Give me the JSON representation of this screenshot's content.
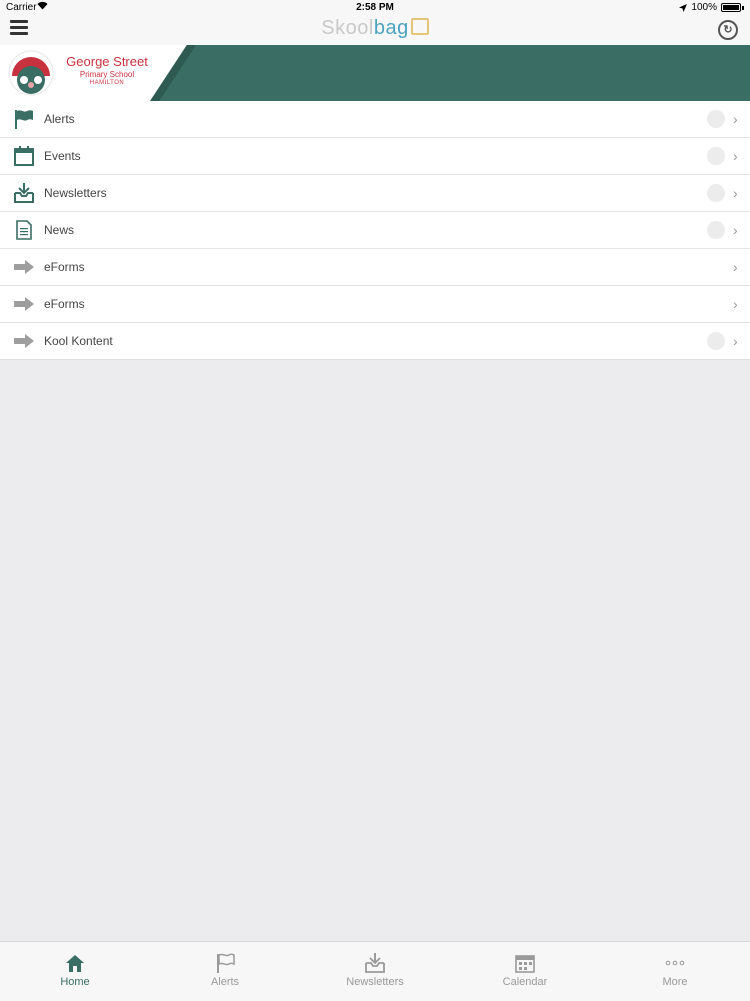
{
  "status": {
    "carrier": "Carrier",
    "time": "2:58 PM",
    "battery": "100%"
  },
  "header": {
    "brand_part1": "Skool",
    "brand_part2": "bag"
  },
  "banner": {
    "school_line1": "George Street",
    "school_line2": "Primary School",
    "school_line3": "HAMILTON",
    "accent": "#3a6d63"
  },
  "menu": {
    "items": [
      {
        "label": "Alerts",
        "icon": "flag-icon",
        "badge": true
      },
      {
        "label": "Events",
        "icon": "calendar-icon",
        "badge": true
      },
      {
        "label": "Newsletters",
        "icon": "inbox-download-icon",
        "badge": true
      },
      {
        "label": "News",
        "icon": "document-icon",
        "badge": true
      },
      {
        "label": "eForms",
        "icon": "arrow-right-icon",
        "badge": false
      },
      {
        "label": "eForms",
        "icon": "arrow-right-icon",
        "badge": false
      },
      {
        "label": "Kool Kontent",
        "icon": "arrow-right-icon",
        "badge": true
      }
    ]
  },
  "tabs": [
    {
      "label": "Home",
      "icon": "home-icon",
      "active": true
    },
    {
      "label": "Alerts",
      "icon": "flag-icon",
      "active": false
    },
    {
      "label": "Newsletters",
      "icon": "inbox-download-icon",
      "active": false
    },
    {
      "label": "Calendar",
      "icon": "calendar-icon",
      "active": false
    },
    {
      "label": "More",
      "icon": "more-dots-icon",
      "active": false
    }
  ]
}
